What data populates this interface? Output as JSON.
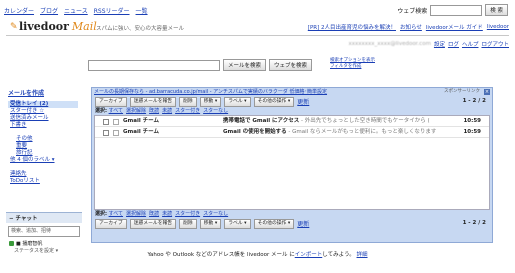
{
  "topnav": [
    "カレンダー",
    "ブログ",
    "ニュース",
    "RSSリーダー",
    "一覧"
  ],
  "websearch": {
    "label": "ウェブ検索",
    "button": "検 索"
  },
  "header": {
    "logo_text": "livedoor",
    "logo_mail": "Mail",
    "tagline": "スパムに強い、安心の大容量メール",
    "promo_link": "[PR] 2人目出産育児の悩みを解決！",
    "links": [
      "お知らせ",
      "livedoorメール ガイド",
      "livedoor"
    ],
    "user_email": "xxxxxxxx_xxxx@livedoor.com",
    "links2": [
      "設定",
      "ログ",
      "ヘルプ",
      "ログアウト"
    ]
  },
  "search": {
    "mail_button": "メールを検索",
    "web_button": "ウェブを検索",
    "opt1": "検索オプションを表示",
    "opt2": "フィルタを作成"
  },
  "compose_label": "メールを作成",
  "sidebar": [
    {
      "label": "受信トレイ (2)",
      "active": true,
      "indent": false
    },
    {
      "label": "スター付き ☆",
      "active": false,
      "indent": false
    },
    {
      "label": "送信済みメール",
      "active": false,
      "indent": false
    },
    {
      "label": "下書き",
      "active": false,
      "indent": false
    },
    {
      "label": "",
      "active": false,
      "indent": false
    },
    {
      "label": "その他",
      "active": false,
      "indent": true
    },
    {
      "label": "重要",
      "active": false,
      "indent": true
    },
    {
      "label": "旅行記",
      "active": false,
      "indent": true
    },
    {
      "label": "他 4 個のラベル ▾",
      "active": false,
      "indent": false
    },
    {
      "label": "",
      "active": false,
      "indent": false
    },
    {
      "label": "連絡先",
      "active": false,
      "indent": false
    },
    {
      "label": "ToDoリスト",
      "active": false,
      "indent": false
    }
  ],
  "chat": {
    "header": "− チャット",
    "input_placeholder": "検索、追加、招待",
    "user": "■ 播磨智帆",
    "status": "ステータスを設定 ▾"
  },
  "panel": {
    "promo": "メールの長期保存なら - ad.barracuda.co.jp/mail - アンチスパムで実績のバラクーダ 低価格･簡単設定",
    "sponsor": "スポンサーリンク",
    "close": "×",
    "buttons": [
      "アーカイブ",
      "迷惑メールを報告",
      "削除",
      "移動 ▾",
      "ラベル ▾",
      "その他の操作 ▾"
    ],
    "refresh": "更新",
    "page": "1 - 2 / 2",
    "select_label": "選択:",
    "select_opts": [
      "すべて",
      "選択解除",
      "既読",
      "未読",
      "スター付き",
      "スターなし"
    ],
    "messages": [
      {
        "from": "Gmail チーム",
        "subject": "携帯電話で Gmail にアクセス",
        "snippet": " - 外出先でちょっとした空き時間でもケータイから (",
        "time": "10:59"
      },
      {
        "from": "Gmail チーム",
        "subject": "Gmail の使用を開始する",
        "snippet": " - Gmail ならメールがもっと便利に。もっと楽しくなります",
        "time": "10:59"
      }
    ]
  },
  "footer": {
    "pre": "Yahoo や Outlook などのアドレス帳を livedoor メール に",
    "link": "インポート",
    "post": "してみよう。",
    "link2": "詳細"
  }
}
